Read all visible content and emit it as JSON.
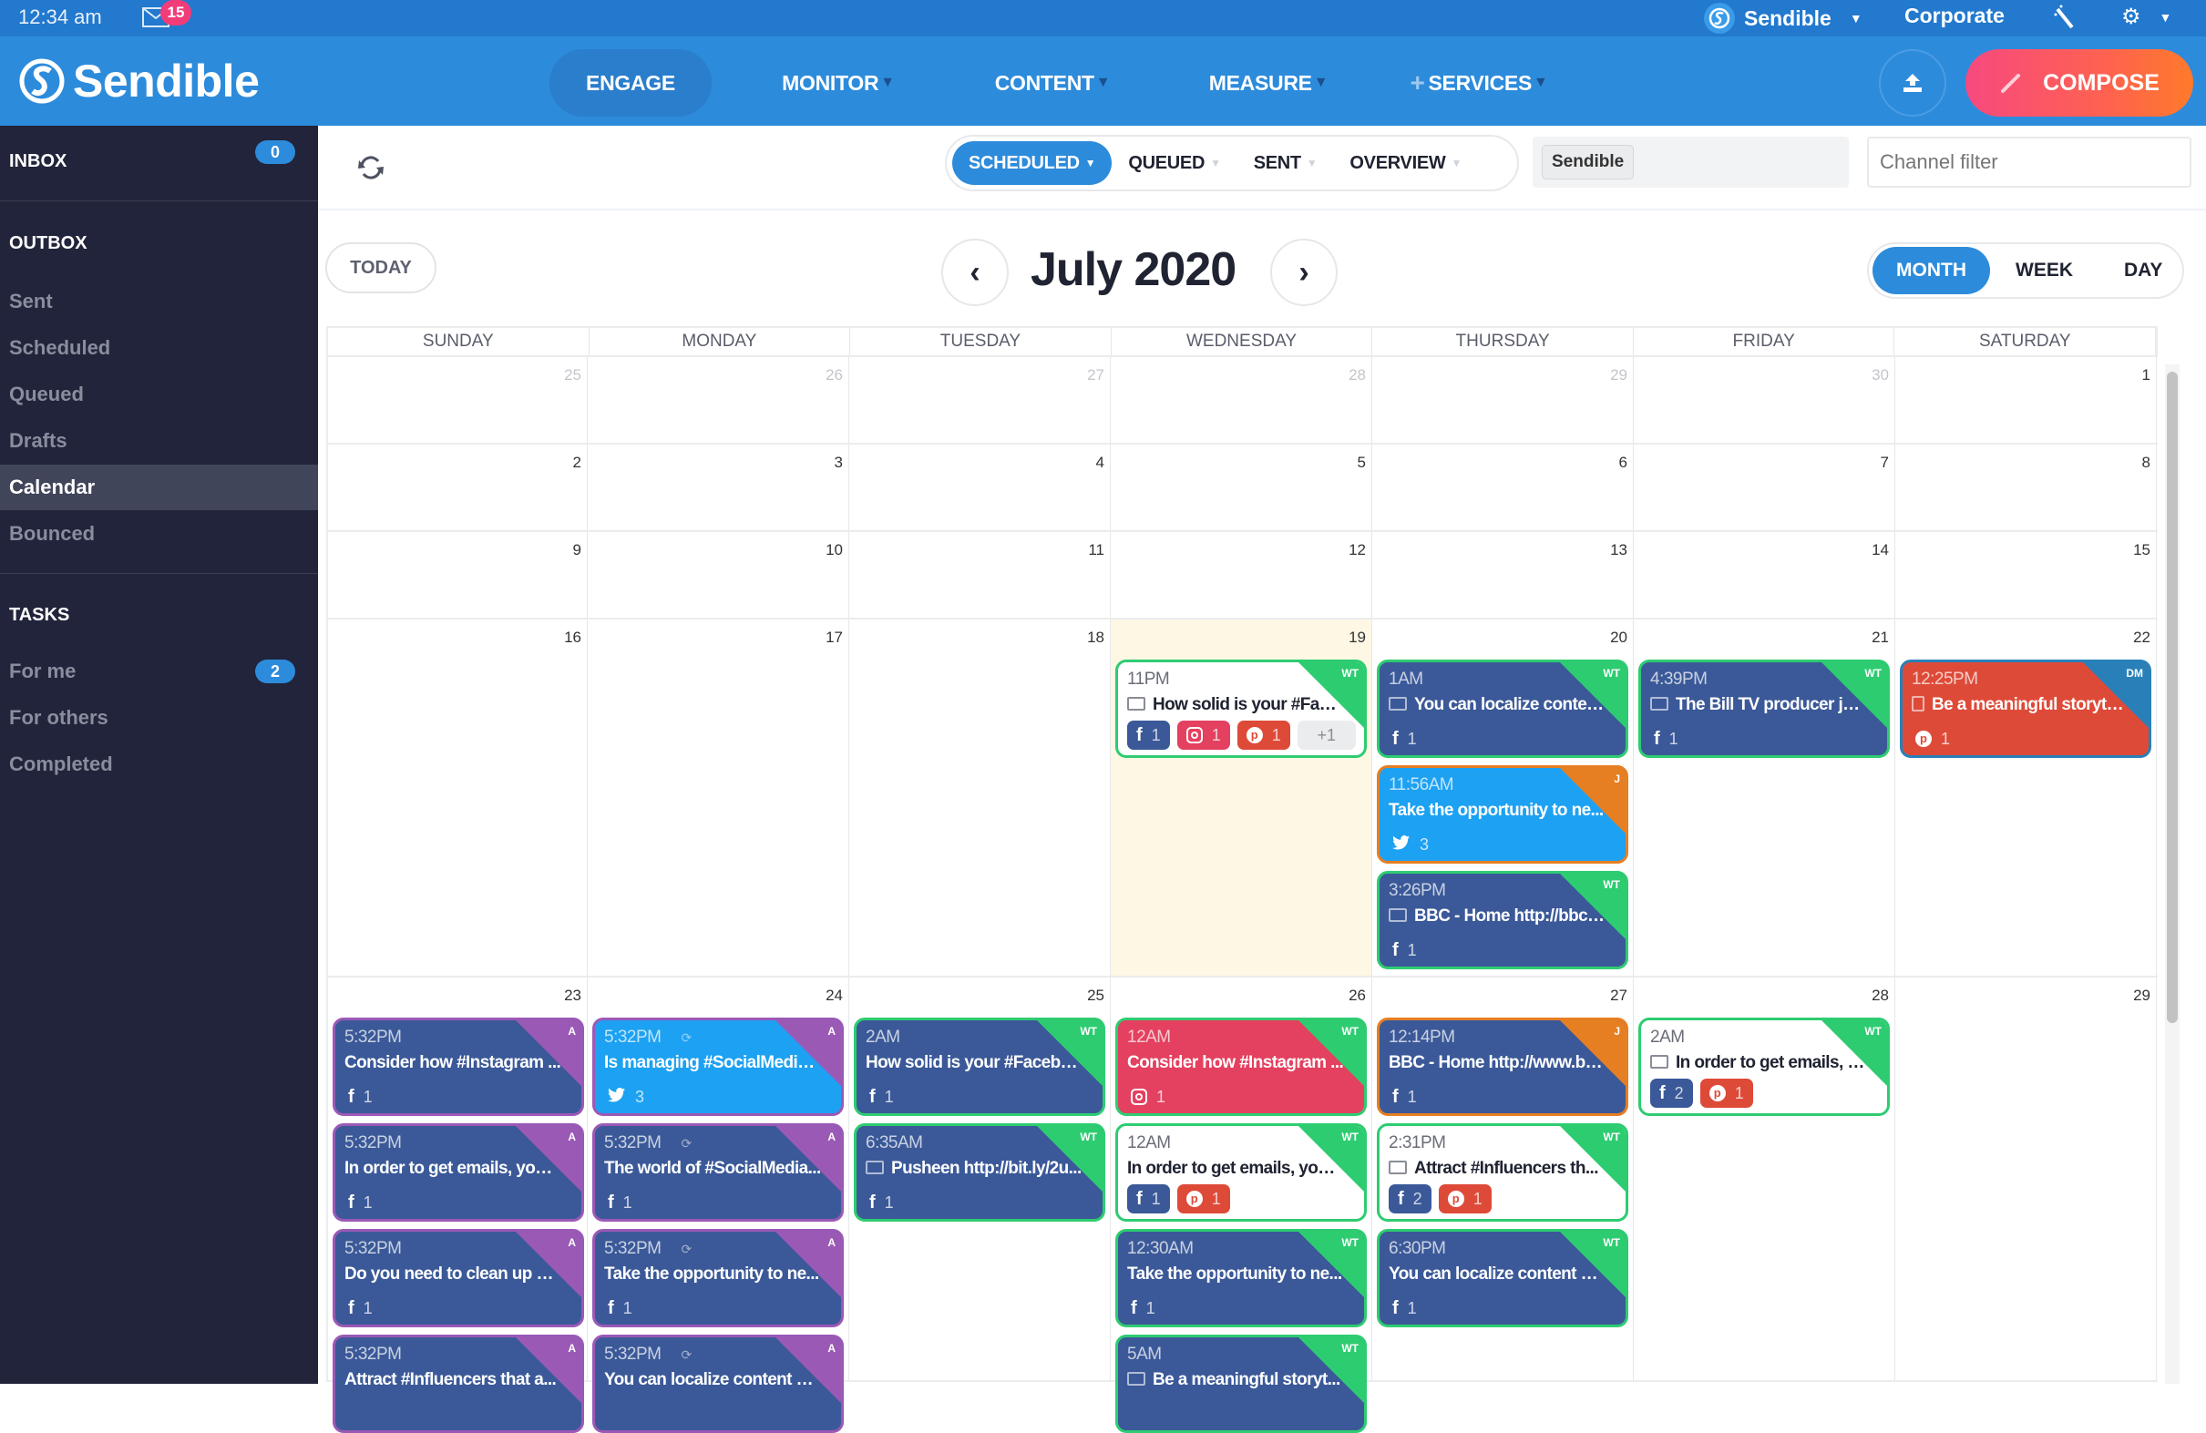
{
  "topbar": {
    "time": "12:34 am",
    "mail_count": "15",
    "account_name": "Sendible",
    "workspace": "Corporate"
  },
  "nav": {
    "brand": "Sendible",
    "items": [
      {
        "label": "ENGAGE",
        "active": true,
        "dropdown": false
      },
      {
        "label": "MONITOR",
        "dropdown": true
      },
      {
        "label": "CONTENT",
        "dropdown": true
      },
      {
        "label": "MEASURE",
        "dropdown": true
      },
      {
        "label": "SERVICES",
        "dropdown": true,
        "prefix": "+"
      }
    ],
    "compose_label": "COMPOSE",
    "brand_colors": {
      "primary": "#2D8BDB",
      "compose_start": "#F7497F",
      "compose_end": "#FF7A2A"
    }
  },
  "sidebar": {
    "inbox_label": "INBOX",
    "inbox_count": "0",
    "outbox_label": "OUTBOX",
    "outbox_items": [
      "Sent",
      "Scheduled",
      "Queued",
      "Drafts",
      "Calendar",
      "Bounced"
    ],
    "active_item": "Calendar",
    "tasks_label": "TASKS",
    "task_items": [
      "For me",
      "For others",
      "Completed"
    ],
    "for_me_count": "2"
  },
  "toolbar": {
    "segments": [
      "SCHEDULED",
      "QUEUED",
      "SENT",
      "OVERVIEW"
    ],
    "active_segment": "SCHEDULED",
    "account_filter_tag": "Sendible",
    "channel_filter_placeholder": "Channel filter"
  },
  "calendar": {
    "today_label": "TODAY",
    "month_title": "July 2020",
    "views": [
      "MONTH",
      "WEEK",
      "DAY"
    ],
    "active_view": "MONTH",
    "weekdays": [
      "SUNDAY",
      "MONDAY",
      "TUESDAY",
      "WEDNESDAY",
      "THURSDAY",
      "FRIDAY",
      "SATURDAY"
    ],
    "weeks": [
      [
        "25",
        "26",
        "27",
        "28",
        "29",
        "30",
        "1"
      ],
      [
        "2",
        "3",
        "4",
        "5",
        "6",
        "7",
        "8"
      ],
      [
        "9",
        "10",
        "11",
        "12",
        "13",
        "14",
        "15"
      ],
      [
        "16",
        "17",
        "18",
        "19",
        "20",
        "21",
        "22"
      ],
      [
        "23",
        "24",
        "25",
        "26",
        "27",
        "28",
        "29"
      ]
    ],
    "today_date": "19",
    "status_colors": {
      "WT": "#2ECC71",
      "J": "#E67E22",
      "DM": "#2980B9",
      "A": "#9B59B6"
    },
    "network_colors": {
      "facebook": "#3B5998",
      "twitter": "#1DA1F2",
      "instagram": "#E4405F",
      "pinterest": "#DE4A38"
    },
    "posts": [
      {
        "week": 3,
        "day": 3,
        "slot": 0,
        "time": "11PM",
        "text": "How solid is your #Face...",
        "style": "white",
        "tag": "WT",
        "icon": "image",
        "nets": [
          {
            "n": "facebook",
            "c": "1"
          },
          {
            "n": "instagram",
            "c": "1"
          },
          {
            "n": "pinterest",
            "c": "1"
          },
          {
            "n": "more",
            "c": "+1"
          }
        ]
      },
      {
        "week": 3,
        "day": 4,
        "slot": 0,
        "time": "1AM",
        "text": "You can localize conten...",
        "style": "facebook",
        "tag": "WT",
        "icon": "image",
        "nets": [
          {
            "n": "facebook",
            "c": "1"
          }
        ]
      },
      {
        "week": 3,
        "day": 4,
        "slot": 1,
        "time": "11:56AM",
        "text": "Take the opportunity to ne...",
        "style": "twitter",
        "tag": "J",
        "nets": [
          {
            "n": "twitter",
            "c": "3"
          }
        ]
      },
      {
        "week": 3,
        "day": 4,
        "slot": 2,
        "time": "3:26PM",
        "text": "BBC - Home http://bbc.i...",
        "style": "facebook",
        "tag": "WT",
        "icon": "image",
        "nets": [
          {
            "n": "facebook",
            "c": "1"
          }
        ]
      },
      {
        "week": 3,
        "day": 5,
        "slot": 0,
        "time": "4:39PM",
        "text": "The Bill TV producer jail...",
        "style": "facebook",
        "tag": "WT",
        "icon": "image",
        "nets": [
          {
            "n": "facebook",
            "c": "1"
          }
        ]
      },
      {
        "week": 3,
        "day": 6,
        "slot": 0,
        "time": "12:25PM",
        "text": "Be a meaningful storytell...",
        "style": "pinterest",
        "tag": "DM",
        "icon": "doc",
        "nets": [
          {
            "n": "pinterest",
            "c": "1"
          }
        ]
      },
      {
        "week": 4,
        "day": 0,
        "slot": 0,
        "time": "5:32PM",
        "text": "Consider how #Instagram ...",
        "style": "facebook",
        "tag": "A",
        "nets": [
          {
            "n": "facebook",
            "c": "1"
          }
        ]
      },
      {
        "week": 4,
        "day": 0,
        "slot": 1,
        "time": "5:32PM",
        "text": "In order to get emails, you h...",
        "style": "facebook",
        "tag": "A",
        "nets": [
          {
            "n": "facebook",
            "c": "1"
          }
        ]
      },
      {
        "week": 4,
        "day": 0,
        "slot": 2,
        "time": "5:32PM",
        "text": "Do you need to clean up yo...",
        "style": "facebook",
        "tag": "A",
        "nets": [
          {
            "n": "facebook",
            "c": "1"
          }
        ]
      },
      {
        "week": 4,
        "day": 0,
        "slot": 3,
        "time": "5:32PM",
        "text": "Attract #Influencers that a...",
        "style": "facebook",
        "tag": "A",
        "nets": []
      },
      {
        "week": 4,
        "day": 1,
        "slot": 0,
        "time": "5:32PM",
        "text": "Is managing #SocialMedia ...",
        "style": "twitter",
        "tag": "A",
        "recurring": true,
        "nets": [
          {
            "n": "twitter",
            "c": "3"
          }
        ]
      },
      {
        "week": 4,
        "day": 1,
        "slot": 1,
        "time": "5:32PM",
        "text": "The world of #SocialMedia...",
        "style": "facebook",
        "tag": "A",
        "recurring": true,
        "nets": [
          {
            "n": "facebook",
            "c": "1"
          }
        ]
      },
      {
        "week": 4,
        "day": 1,
        "slot": 2,
        "time": "5:32PM",
        "text": "Take the opportunity to ne...",
        "style": "facebook",
        "tag": "A",
        "recurring": true,
        "nets": [
          {
            "n": "facebook",
            "c": "1"
          }
        ]
      },
      {
        "week": 4,
        "day": 1,
        "slot": 3,
        "time": "5:32PM",
        "text": "You can localize content w...",
        "style": "facebook",
        "tag": "A",
        "recurring": true,
        "nets": []
      },
      {
        "week": 4,
        "day": 2,
        "slot": 0,
        "time": "2AM",
        "text": "How solid is your #Facebo...",
        "style": "facebook",
        "tag": "WT",
        "nets": [
          {
            "n": "facebook",
            "c": "1"
          }
        ]
      },
      {
        "week": 4,
        "day": 2,
        "slot": 1,
        "time": "6:35AM",
        "text": "Pusheen http://bit.ly/2u...",
        "style": "facebook",
        "tag": "WT",
        "icon": "image",
        "nets": [
          {
            "n": "facebook",
            "c": "1"
          }
        ]
      },
      {
        "week": 4,
        "day": 3,
        "slot": 0,
        "time": "12AM",
        "text": "Consider how #Instagram ...",
        "style": "instagram",
        "tag": "WT",
        "nets": [
          {
            "n": "instagram",
            "c": "1"
          }
        ]
      },
      {
        "week": 4,
        "day": 3,
        "slot": 1,
        "time": "12AM",
        "text": "In order to get emails, you ...",
        "style": "white",
        "tag": "WT",
        "nets": [
          {
            "n": "facebook",
            "c": "1"
          },
          {
            "n": "pinterest",
            "c": "1"
          }
        ]
      },
      {
        "week": 4,
        "day": 3,
        "slot": 2,
        "time": "12:30AM",
        "text": "Take the opportunity to ne...",
        "style": "facebook",
        "tag": "WT",
        "nets": [
          {
            "n": "facebook",
            "c": "1"
          }
        ]
      },
      {
        "week": 4,
        "day": 3,
        "slot": 3,
        "time": "5AM",
        "text": "Be a meaningful storyt...",
        "style": "facebook",
        "tag": "WT",
        "icon": "image",
        "nets": []
      },
      {
        "week": 4,
        "day": 4,
        "slot": 0,
        "time": "12:14PM",
        "text": "BBC - Home http://www.bb...",
        "style": "facebook",
        "tag": "J",
        "nets": [
          {
            "n": "facebook",
            "c": "1"
          }
        ]
      },
      {
        "week": 4,
        "day": 4,
        "slot": 1,
        "time": "2:31PM",
        "text": "Attract #Influencers th...",
        "style": "white",
        "tag": "WT",
        "icon": "image",
        "nets": [
          {
            "n": "facebook",
            "c": "2"
          },
          {
            "n": "pinterest",
            "c": "1"
          }
        ]
      },
      {
        "week": 4,
        "day": 4,
        "slot": 2,
        "time": "6:30PM",
        "text": "You can localize content w...",
        "style": "facebook",
        "tag": "WT",
        "nets": [
          {
            "n": "facebook",
            "c": "1"
          }
        ]
      },
      {
        "week": 4,
        "day": 5,
        "slot": 0,
        "time": "2AM",
        "text": "In order to get emails, y...",
        "style": "white",
        "tag": "WT",
        "icon": "image",
        "nets": [
          {
            "n": "facebook",
            "c": "2"
          },
          {
            "n": "pinterest",
            "c": "1"
          }
        ]
      }
    ]
  }
}
